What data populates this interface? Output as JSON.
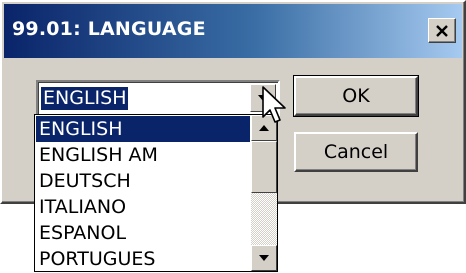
{
  "window": {
    "title": "99.01: LANGUAGE",
    "close_icon": "close-icon"
  },
  "combo": {
    "selected_value": "ENGLISH",
    "arrow_icon": "chevron-down-icon"
  },
  "buttons": {
    "ok_label": "OK",
    "cancel_label": "Cancel"
  },
  "dropdown": {
    "items": [
      {
        "label": "ENGLISH",
        "selected": true
      },
      {
        "label": "ENGLISH AM",
        "selected": false
      },
      {
        "label": "DEUTSCH",
        "selected": false
      },
      {
        "label": "ITALIANO",
        "selected": false
      },
      {
        "label": "ESPANOL",
        "selected": false
      },
      {
        "label": "PORTUGUES",
        "selected": false
      }
    ],
    "scroll_up_icon": "arrow-up-icon",
    "scroll_down_icon": "arrow-down-icon"
  },
  "colors": {
    "title_start": "#0a246a",
    "title_end": "#a6caf0",
    "selection": "#0a246a",
    "face": "#d4d0c8"
  }
}
